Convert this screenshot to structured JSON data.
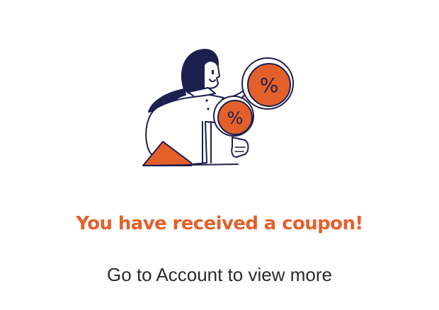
{
  "illustration": {
    "icon": "coupon-person-illustration",
    "badge_symbol_large": "%",
    "badge_symbol_small": "%"
  },
  "message": {
    "title": "You have received a coupon!",
    "subtitle": "Go to Account to view more"
  },
  "colors": {
    "accent": "#E4602A",
    "outline": "#1D1F4E",
    "text": "#2B2B2B",
    "background": "#FFFFFF"
  }
}
